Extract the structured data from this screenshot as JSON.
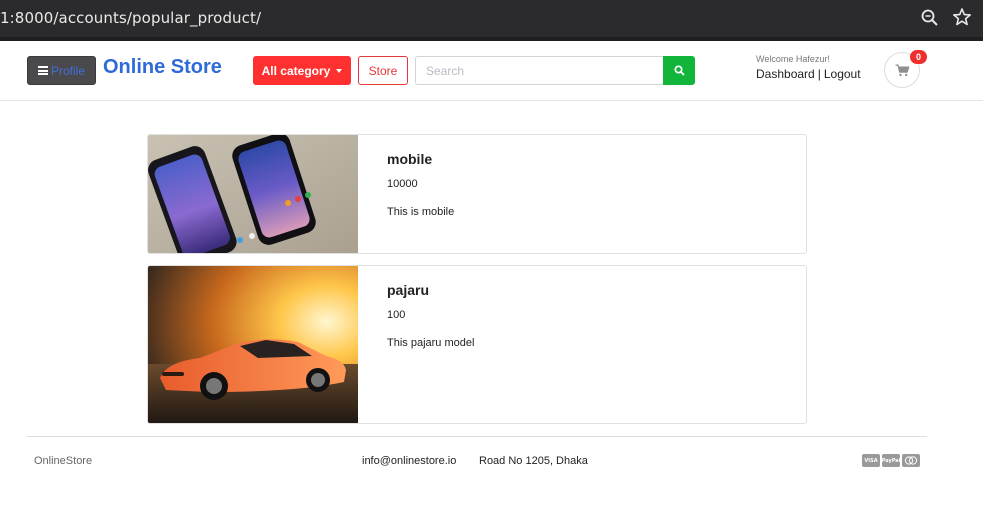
{
  "browser": {
    "url": "1:8000/accounts/popular_product/",
    "icons": [
      "zoom-icon",
      "star-icon"
    ]
  },
  "header": {
    "profile_label": "Profile",
    "brand": "Online Store",
    "category_label": "All category",
    "store_label": "Store",
    "search_placeholder": "Search",
    "search_value": "",
    "welcome": "Welcome Hafezur!",
    "dashboard_label": "Dashboard",
    "separator": "|",
    "logout_label": "Logout",
    "cart_count": "0",
    "colors": {
      "brand": "#2f6ad9",
      "category_bg": "#ff3030",
      "search_button": "#11b53a",
      "badge": "#ef2f2f"
    }
  },
  "products": [
    {
      "name": "mobile",
      "price": "10000",
      "description": "This is mobile",
      "image": "smartphones-photo"
    },
    {
      "name": "pajaru",
      "price": "100",
      "description": "This pajaru model",
      "image": "orange-sports-car-photo"
    }
  ],
  "footer": {
    "brand": "OnlineStore",
    "email": "info@onlinestore.io",
    "address": "Road No 1205, Dhaka",
    "payment_icons": [
      {
        "name": "visa-icon",
        "label": "VISA"
      },
      {
        "name": "paypal-icon",
        "label": "PayPal"
      },
      {
        "name": "mastercard-icon",
        "label": ""
      }
    ]
  }
}
